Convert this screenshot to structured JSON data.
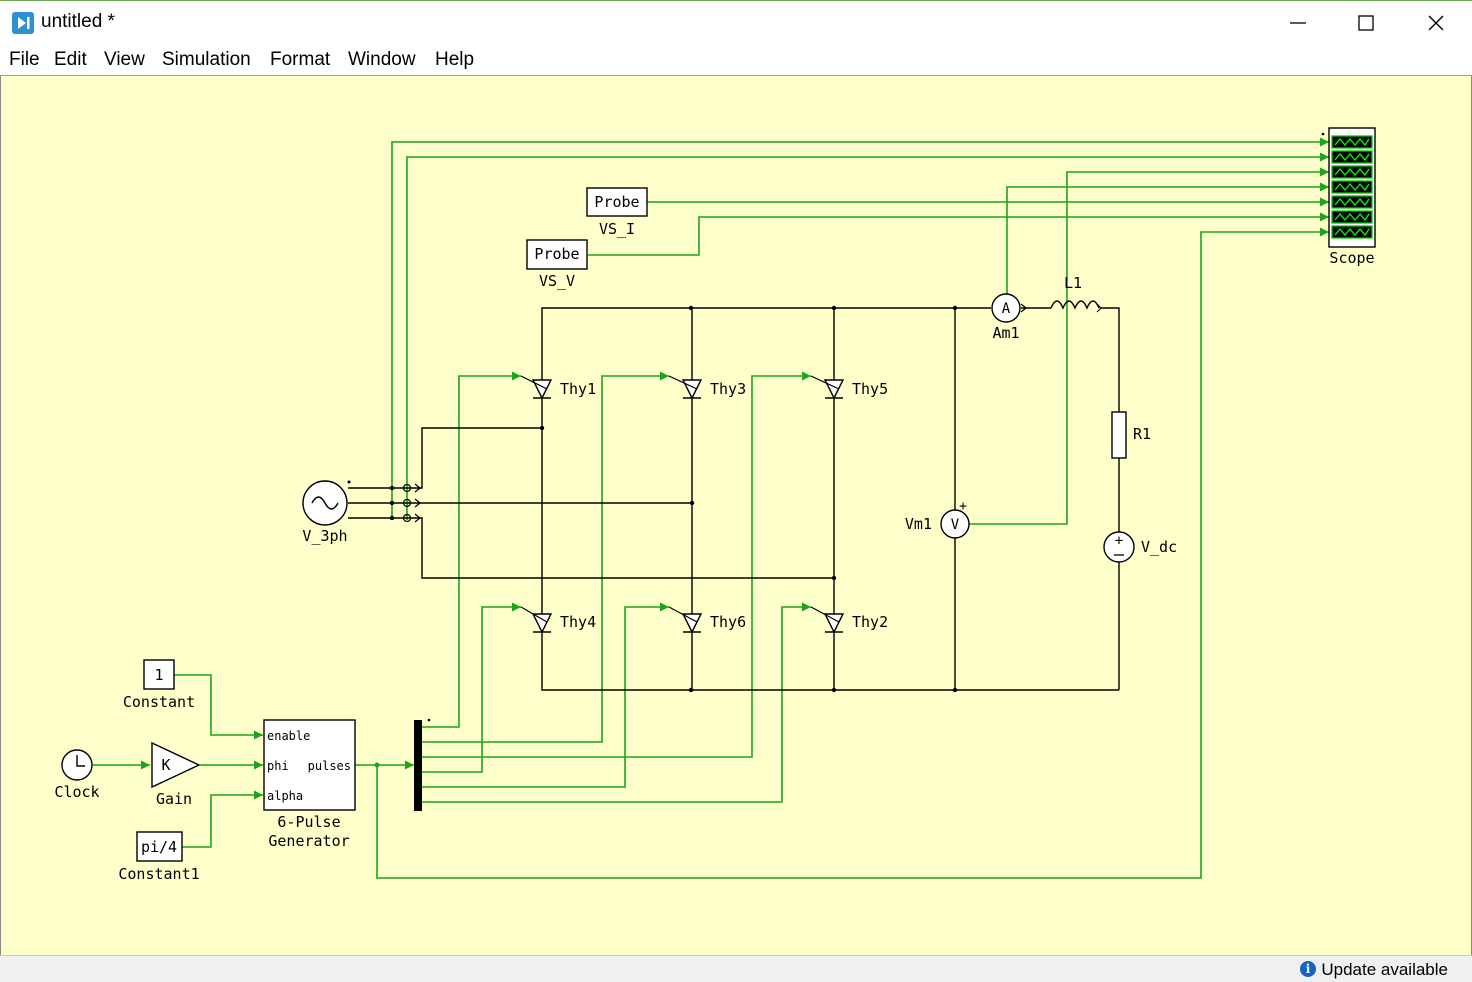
{
  "window": {
    "title": "untitled *"
  },
  "menu": [
    "File",
    "Edit",
    "View",
    "Simulation",
    "Format",
    "Window",
    "Help"
  ],
  "diagram": {
    "blocks": {
      "probe_i_text": "Probe",
      "probe_i_label": "VS_I",
      "probe_v_text": "Probe",
      "probe_v_label": "VS_V",
      "scope_label": "Scope",
      "am1_label": "Am1",
      "am1_symbol": "A",
      "l1_label": "L1",
      "r1_label": "R1",
      "vdc_label": "V_dc",
      "vm1_label": "Vm1",
      "vm1_symbol": "V",
      "v3ph_label": "V_3ph",
      "thy1": "Thy1",
      "thy3": "Thy3",
      "thy5": "Thy5",
      "thy4": "Thy4",
      "thy6": "Thy6",
      "thy2": "Thy2",
      "constant_value": "1",
      "constant_label": "Constant",
      "gain_symbol": "K",
      "gain_label": "Gain",
      "clock_label": "Clock",
      "constant1_value": "pi/4",
      "constant1_label": "Constant1",
      "gen_port_enable": "enable",
      "gen_port_phi": "phi",
      "gen_port_alpha": "alpha",
      "gen_port_pulses": "pulses",
      "gen_label_1": "6-Pulse",
      "gen_label_2": "Generator"
    }
  },
  "status": {
    "text": "Update available"
  },
  "colors": {
    "signal": "#1aa51a",
    "canvas": "#ffffcc",
    "block_fill": "#ffffff",
    "scope_trace": "#00cc00"
  }
}
